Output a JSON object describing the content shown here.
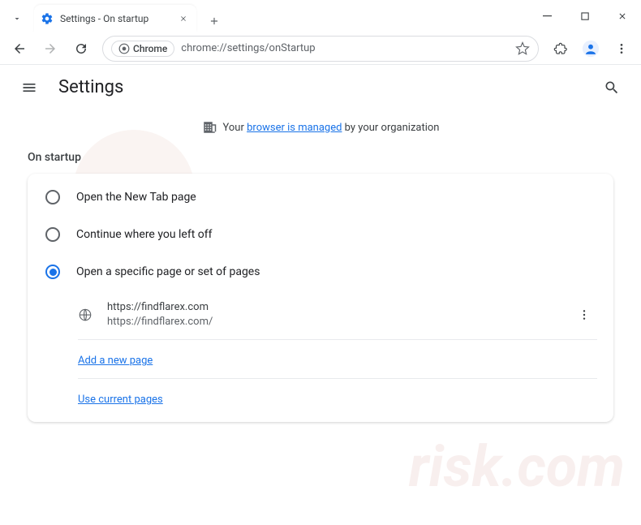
{
  "window": {
    "tab_title": "Settings - On startup",
    "tab_favicon": "gear-icon"
  },
  "toolbar": {
    "site_chip": "Chrome",
    "url": "chrome://settings/onStartup"
  },
  "header": {
    "title": "Settings"
  },
  "managed": {
    "prefix": "Your ",
    "link": "browser is managed",
    "suffix": " by your organization"
  },
  "section": {
    "title": "On startup",
    "options": [
      {
        "label": "Open the New Tab page",
        "selected": false
      },
      {
        "label": "Continue where you left off",
        "selected": false
      },
      {
        "label": "Open a specific page or set of pages",
        "selected": true
      }
    ],
    "startup_page": {
      "url": "https://findflarex.com",
      "sub": "https://findflarex.com/"
    },
    "links": {
      "add": "Add a new page",
      "use_current": "Use current pages"
    }
  }
}
